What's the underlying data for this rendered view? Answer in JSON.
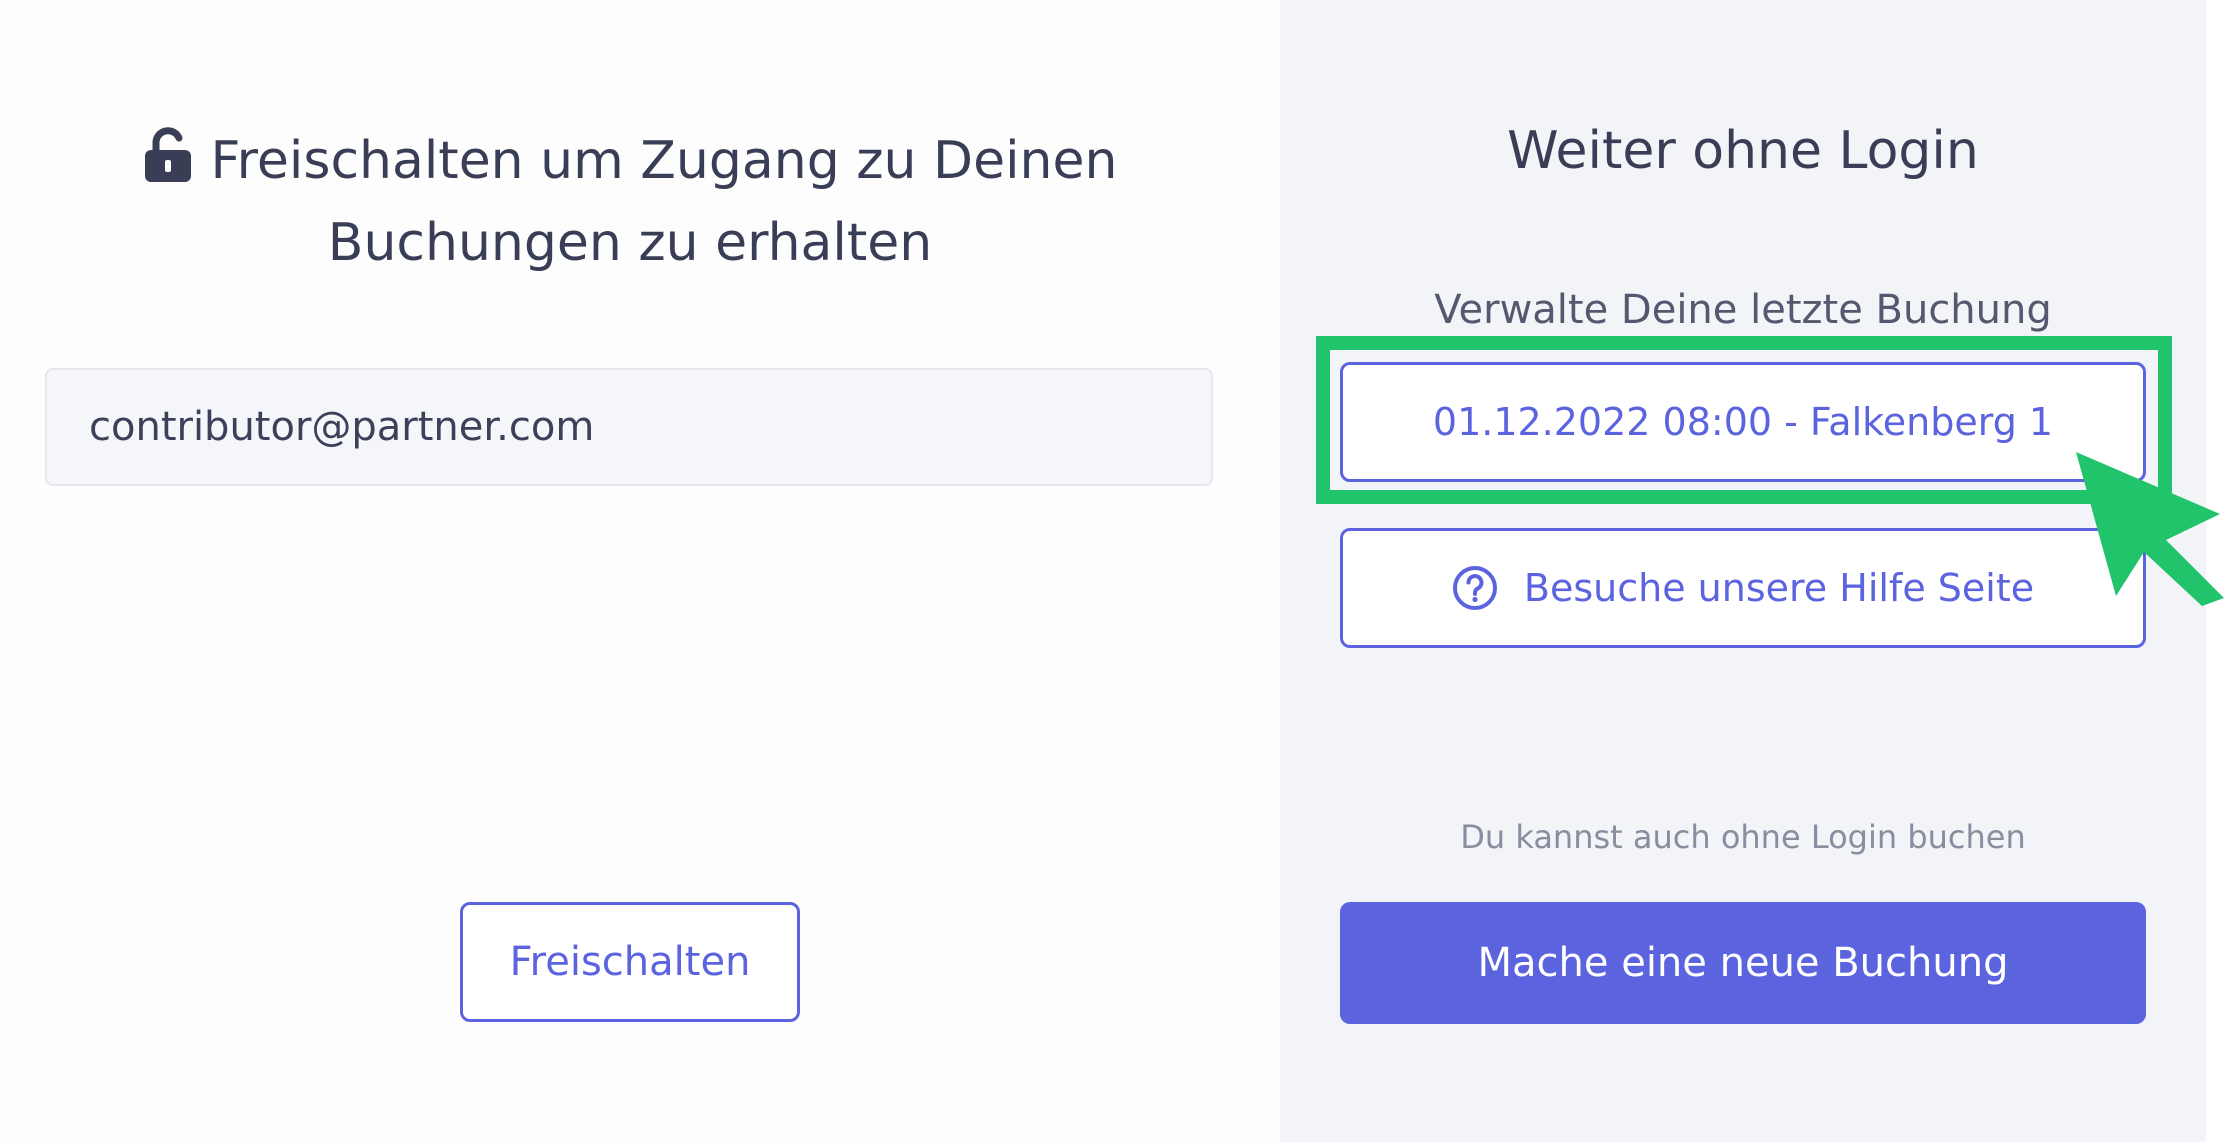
{
  "left": {
    "title_line1": "Freischalten um Zugang zu Deinen",
    "title_line2": "Buchungen zu erhalten",
    "email_value": "contributor@partner.com",
    "unlock_label": "Freischalten"
  },
  "right": {
    "title": "Weiter ohne Login",
    "manage_label": "Verwalte Deine letzte Buchung",
    "last_booking_label": "01.12.2022 08:00 - Falkenberg 1",
    "help_label": "Besuche unsere Hilfe Seite",
    "hint": "Du kannst auch ohne Login buchen",
    "new_booking_label": "Mache eine neue Buchung"
  },
  "icons": {
    "lock": "unlocked-padlock-icon",
    "help": "question-circle-icon",
    "cursor": "arrow-pointer-icon"
  },
  "colors": {
    "accent": "#5b63de",
    "highlight": "#21c46a",
    "text": "#3a3d56",
    "right_bg": "#f3f4f8"
  }
}
